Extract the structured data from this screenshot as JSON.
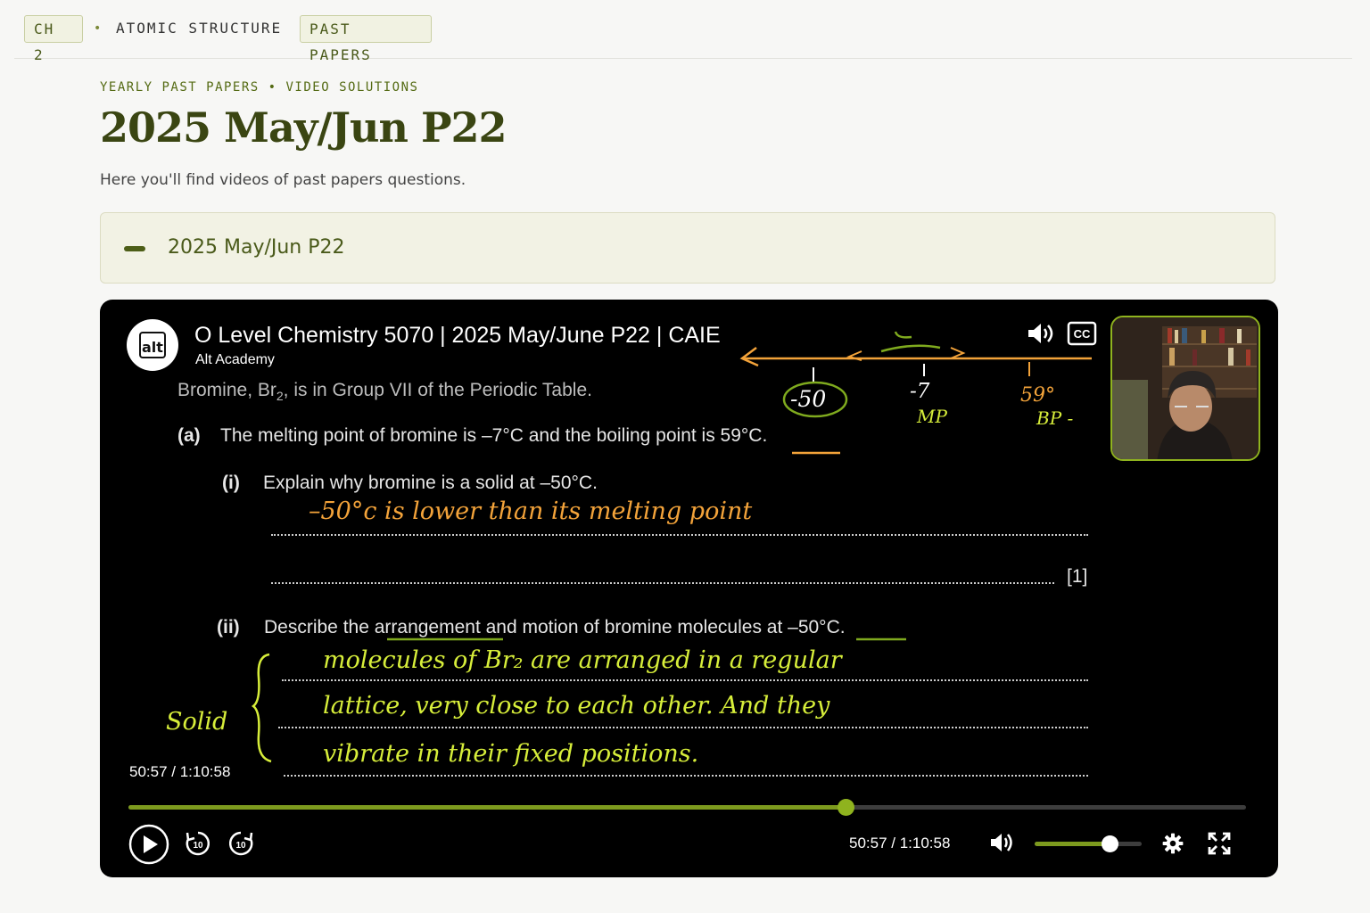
{
  "breadcrumb": {
    "chapter": "CH 2",
    "separator": "•",
    "topic": "ATOMIC STRUCTURE",
    "section": "PAST PAPERS"
  },
  "header": {
    "eyebrow": "YEARLY PAST PAPERS • VIDEO SOLUTIONS",
    "title": "2025 May/Jun P22",
    "subtitle": "Here you'll find videos of past papers questions."
  },
  "accordion": {
    "label": "2025 May/Jun P22",
    "expanded": true
  },
  "video": {
    "title": "O Level Chemistry 5070 | 2025 May/June P22 | CAIE",
    "channel": "Alt Academy",
    "logo_text": "alt",
    "current_time": "50:57",
    "duration": "1:10:58",
    "time_display": "50:57 / 1:10:58",
    "progress_fraction": 0.6414,
    "volume_fraction": 0.7,
    "skip_seconds_label": "10",
    "cc_label": "CC",
    "icons": {
      "top_volume": "volume-icon",
      "top_cc": "captions-icon",
      "top_settings": "gear-icon",
      "play": "play-icon",
      "rewind": "rewind-10-icon",
      "forward": "forward-10-icon",
      "volume": "volume-icon",
      "settings": "gear-icon",
      "fullscreen": "fullscreen-icon"
    },
    "accent_color": "#8fb31e"
  },
  "question": {
    "intro_pre": "Bromine, Br",
    "intro_sub": "2",
    "intro_post": ", is in Group VII of the Periodic Table.",
    "a_label": "(a)",
    "a_text": "The melting point of bromine is –7°C and the boiling point is 59°C.",
    "i_label": "(i)",
    "i_text": "Explain why bromine is a solid at –50°C.",
    "i_marks": "[1]",
    "ii_label": "(ii)",
    "ii_text": "Describe the arrangement and motion of bromine molecules at –50°C."
  },
  "annotations": {
    "number_line": {
      "minus50": "-50",
      "minus7": "-7",
      "mp": "MP",
      "bp_value": "59°",
      "bp": "BP -"
    },
    "answer_i": "–50°c   is   lower   than   its   melting  point",
    "answer_ii_line1": "molecules  of  Br₂  are  arranged  in  a  regular",
    "answer_ii_line2": "lattice,  very  close  to  each  other.  And  they",
    "answer_ii_line3": "vibrate  in  their  fixed  positions.",
    "side_note": "Solid"
  }
}
